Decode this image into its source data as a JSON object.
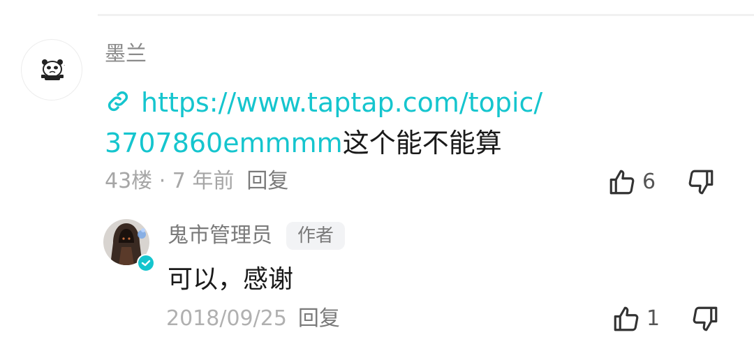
{
  "comment": {
    "username": "墨兰",
    "link_text_line1": "https://www.taptap.com/topic/",
    "link_text_line2": "3707860emmmm",
    "text_after_link": "这个能不能算",
    "floor": "43楼",
    "separator": " · ",
    "time": "7 年前",
    "reply_label": "回复",
    "like_count": "6",
    "icons": {
      "avatar": "panda-avatar-icon",
      "link": "link-icon",
      "like": "thumbs-up-icon",
      "dislike": "thumbs-down-icon"
    }
  },
  "reply": {
    "username": "鬼市管理员",
    "badge": "作者",
    "text": "可以，感谢",
    "date": "2018/09/25",
    "reply_label": "回复",
    "like_count": "1",
    "icons": {
      "avatar": "hooded-figure-avatar-icon",
      "verified": "verified-check-icon",
      "like": "thumbs-up-icon",
      "dislike": "thumbs-down-icon"
    }
  },
  "colors": {
    "accent": "#15c5ce",
    "text_primary": "#1a1a1a",
    "text_secondary": "#8a8a8a",
    "text_muted": "#a6a6a6"
  }
}
